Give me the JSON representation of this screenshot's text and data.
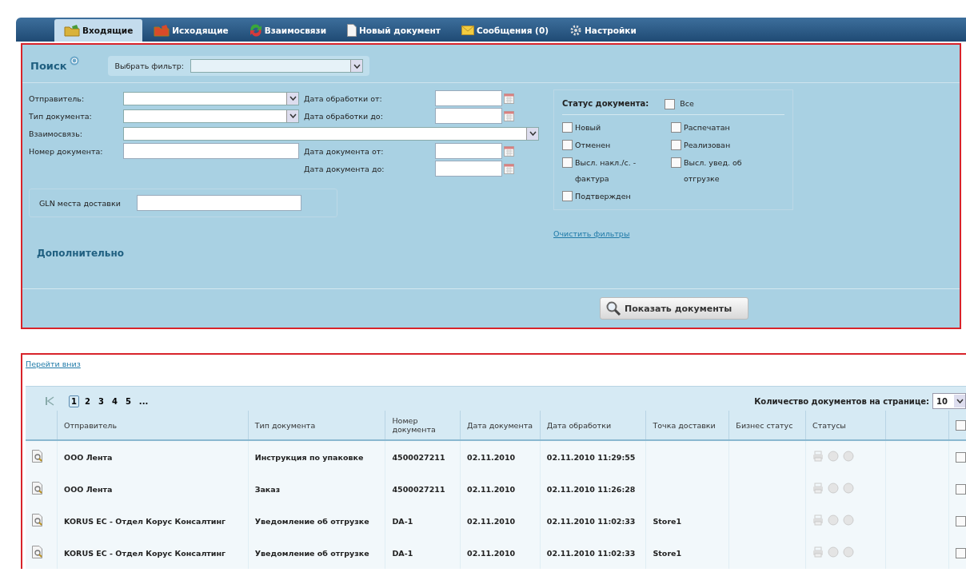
{
  "tabs": [
    {
      "label": "Входящие",
      "selected": true
    },
    {
      "label": "Исходящие",
      "selected": false
    },
    {
      "label": "Взаимосвязи",
      "selected": false
    },
    {
      "label": "Новый документ",
      "selected": false
    },
    {
      "label": "Сообщения (0)",
      "selected": false
    },
    {
      "label": "Настройки",
      "selected": false
    }
  ],
  "search": {
    "title": "Поиск",
    "filter_label": "Выбрать фильтр:",
    "fields_left": [
      {
        "label": "Отправитель:",
        "kind": "select"
      },
      {
        "label": "Тип документа:",
        "kind": "select"
      },
      {
        "label": "Взаимосвязь:",
        "kind": "wide"
      },
      {
        "label": "Номер документа:",
        "kind": "text"
      }
    ],
    "date_fields": [
      {
        "label": "Дата обработки от:"
      },
      {
        "label": "Дата обработки до:"
      },
      {
        "label": "Дата документа от:"
      },
      {
        "label": "Дата документа до:"
      }
    ],
    "gln_label": "GLN места доставки",
    "status": {
      "title": "Статус документа:",
      "all": {
        "label": "Все",
        "checked": false
      },
      "options": [
        {
          "label": "Новый",
          "checked": false
        },
        {
          "label": "Распечатан",
          "checked": false
        },
        {
          "label": "Отменен",
          "checked": false
        },
        {
          "label": "Реализован",
          "checked": false
        },
        {
          "label": "Высл. накл./с. - фактура",
          "checked": false
        },
        {
          "label": "Высл. увед. об отгрузке",
          "checked": false
        },
        {
          "label": "Подтвержден",
          "checked": false
        }
      ]
    },
    "clear_link": "Очистить фильтры",
    "more": "Дополнительно",
    "submit": "Показать документы"
  },
  "results": {
    "jump_link": "Перейти вниз",
    "pages": [
      {
        "label": "1",
        "selected": true
      },
      {
        "label": "2",
        "selected": false
      },
      {
        "label": "3",
        "selected": false
      },
      {
        "label": "4",
        "selected": false
      },
      {
        "label": "5",
        "selected": false
      },
      {
        "label": "...",
        "selected": false
      }
    ],
    "per_page_label": "Количество документов на странице:",
    "per_page": "10",
    "columns": [
      "Отправитель",
      "Тип документа",
      "Номер документа",
      "Дата документа",
      "Дата обработки",
      "Точка доставки",
      "Бизнес статус",
      "Статусы"
    ],
    "header_checked": false,
    "rows": [
      {
        "sender": "ООО Лента",
        "type": "Инструкция по упаковке",
        "number": "4500027211",
        "date": "02.11.2010",
        "processed": "02.11.2010 11:29:55",
        "point": "",
        "checked": false
      },
      {
        "sender": "ООО Лента",
        "type": "Заказ",
        "number": "4500027211",
        "date": "02.11.2010",
        "processed": "02.11.2010 11:26:28",
        "point": "",
        "checked": false
      },
      {
        "sender": "KORUS EC - Отдел Корус Консалтинг",
        "type": "Уведомление об отгрузке",
        "number": "DA-1",
        "date": "02.11.2010",
        "processed": "02.11.2010 11:02:33",
        "point": "Store1",
        "checked": false
      },
      {
        "sender": "KORUS EC - Отдел Корус Консалтинг",
        "type": "Уведомление об отгрузке",
        "number": "DA-1",
        "date": "02.11.2010",
        "processed": "02.11.2010 11:02:33",
        "point": "Store1",
        "checked": false
      }
    ]
  }
}
